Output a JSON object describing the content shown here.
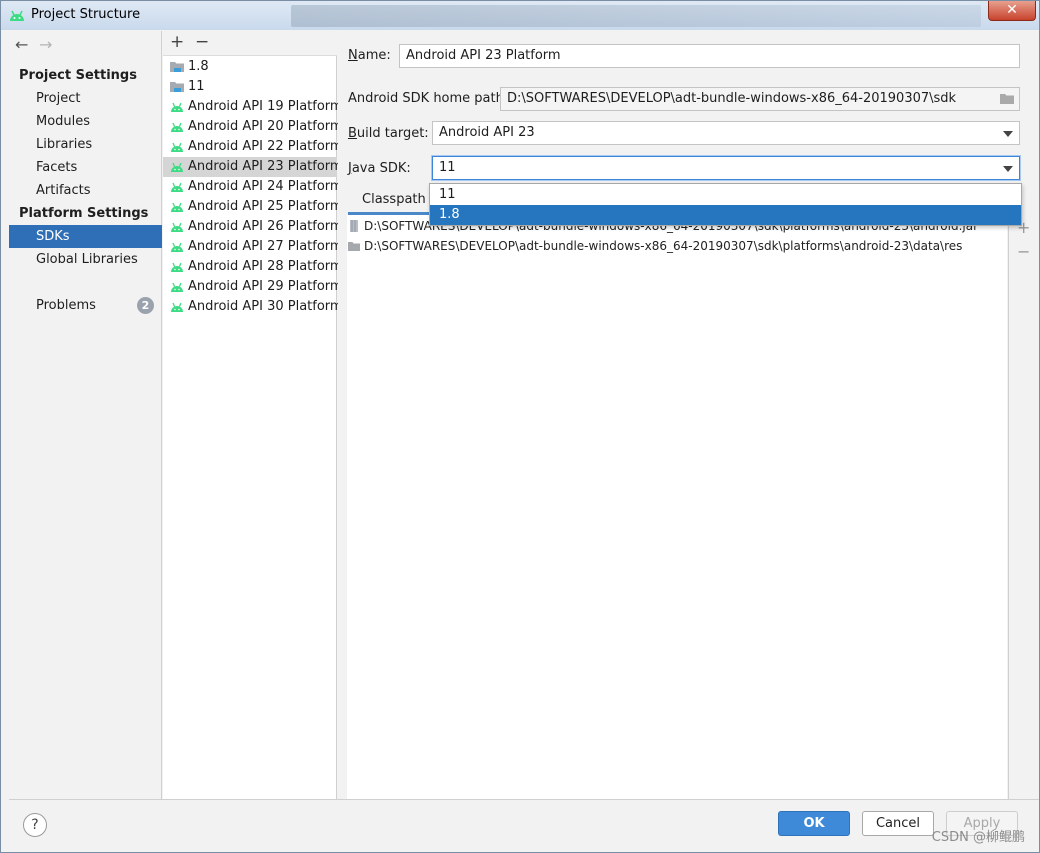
{
  "window": {
    "title": "Project Structure",
    "close_label": "✕"
  },
  "nav": {
    "back": "←",
    "forward": "→",
    "project_settings_header": "Project Settings",
    "project_settings": [
      "Project",
      "Modules",
      "Libraries",
      "Facets",
      "Artifacts"
    ],
    "platform_settings_header": "Platform Settings",
    "platform_settings": [
      "SDKs",
      "Global Libraries"
    ],
    "selected": "SDKs",
    "problems_label": "Problems",
    "problems_count": "2"
  },
  "sdk_list": {
    "add": "+",
    "remove": "−",
    "items": [
      {
        "label": "1.8",
        "type": "jdk"
      },
      {
        "label": "11",
        "type": "jdk"
      },
      {
        "label": "Android API 19 Platform",
        "type": "android"
      },
      {
        "label": "Android API 20 Platform",
        "type": "android"
      },
      {
        "label": "Android API 22 Platform",
        "type": "android"
      },
      {
        "label": "Android API 23 Platform",
        "type": "android"
      },
      {
        "label": "Android API 24 Platform",
        "type": "android"
      },
      {
        "label": "Android API 25 Platform",
        "type": "android"
      },
      {
        "label": "Android API 26 Platform",
        "type": "android"
      },
      {
        "label": "Android API 27 Platform",
        "type": "android"
      },
      {
        "label": "Android API 28 Platform",
        "type": "android"
      },
      {
        "label": "Android API 29 Platform",
        "type": "android"
      },
      {
        "label": "Android API 30 Platform",
        "type": "android"
      }
    ],
    "selected": "Android API 23 Platform"
  },
  "details": {
    "name_label_mnemonic": "N",
    "name_label_rest": "ame:",
    "name_value": "Android API 23 Platform",
    "sdk_home_label": "Android SDK home path:",
    "sdk_home_value": "D:\\SOFTWARES\\DEVELOP\\adt-bundle-windows-x86_64-20190307\\sdk",
    "build_target_mnemonic": "B",
    "build_target_rest": "uild target:",
    "build_target_value": "Android API 23",
    "java_sdk_mnemonic": "J",
    "java_sdk_rest": "ava SDK:",
    "java_sdk_value": "11",
    "tab_classpath": "Classpath",
    "classpath": [
      {
        "path": "D:\\SOFTWARES\\DEVELOP\\adt-bundle-windows-x86_64-20190307\\sdk\\platforms\\android-23\\android.jar",
        "icon": "jar-icon"
      },
      {
        "path": "D:\\SOFTWARES\\DEVELOP\\adt-bundle-windows-x86_64-20190307\\sdk\\platforms\\android-23\\data\\res",
        "icon": "folder-icon"
      }
    ],
    "side_add": "+",
    "side_remove": "−"
  },
  "popup": {
    "options": [
      "11",
      "1.8"
    ],
    "highlighted": "1.8"
  },
  "footer": {
    "help": "?",
    "ok": "OK",
    "cancel": "Cancel",
    "apply": "Apply",
    "watermark": "CSDN @柳鲲鹏"
  },
  "colors": {
    "selection_blue": "#2f6fb7",
    "android_green": "#3ddc84",
    "primary_button": "#3e8ad8"
  }
}
